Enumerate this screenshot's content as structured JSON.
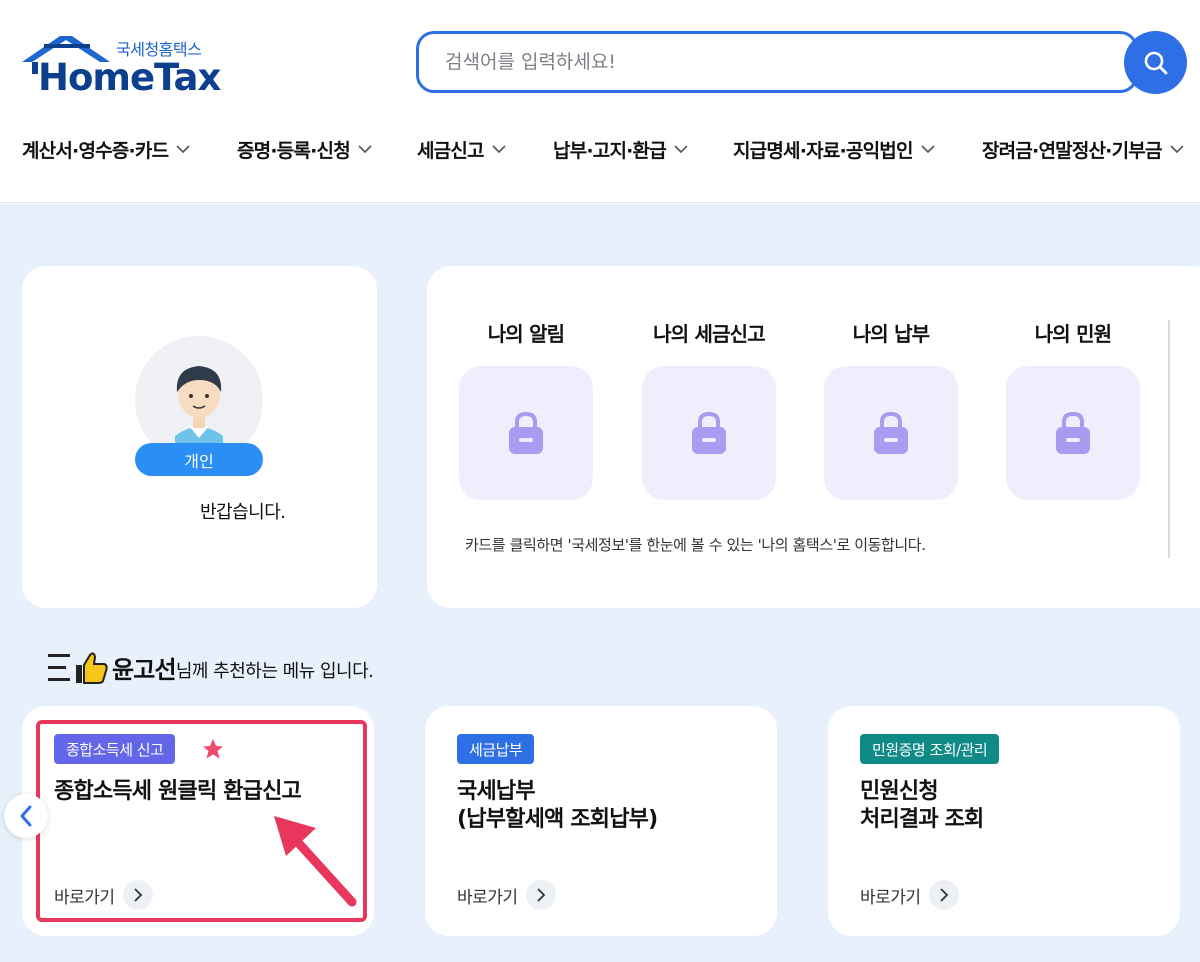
{
  "brand": {
    "sub": "국세청홈택스",
    "name": "HomeTax",
    "house_color": "#1e66cf"
  },
  "search": {
    "placeholder": "검색어를 입력하세요!"
  },
  "nav": {
    "items": [
      {
        "label": "계산서·영수증·카드"
      },
      {
        "label": "증명·등록·신청"
      },
      {
        "label": "세금신고"
      },
      {
        "label": "납부·고지·환급"
      },
      {
        "label": "지급명세·자료·공익법인"
      },
      {
        "label": "장려금·연말정산·기부금"
      }
    ]
  },
  "profile": {
    "badge": "개인",
    "greeting": "반갑습니다."
  },
  "my_services": {
    "items": [
      {
        "title": "나의 알림",
        "icon": "lock-icon"
      },
      {
        "title": "나의 세금신고",
        "icon": "lock-icon"
      },
      {
        "title": "나의 납부",
        "icon": "lock-icon"
      },
      {
        "title": "나의 민원",
        "icon": "lock-icon"
      }
    ],
    "note": "카드를 클릭하면 '국세정보'를 한눈에 볼 수 있는 '나의 홈택스'로 이동합니다."
  },
  "recommend": {
    "user_name": "윤고선",
    "suffix": "님께 추천하는 메뉴 입니다.",
    "cards": [
      {
        "tag": "종합소득세 신고",
        "tag_color": "#6366e8",
        "title_line1": "종합소득세 원클릭 환급신고",
        "title_line2": "",
        "go": "바로가기",
        "starred": true
      },
      {
        "tag": "세금납부",
        "tag_color": "#2f6fe6",
        "title_line1": "국세납부",
        "title_line2": "(납부할세액 조회납부)",
        "go": "바로가기",
        "starred": false
      },
      {
        "tag": "민원증명 조회/관리",
        "tag_color": "#0f8a86",
        "title_line1": "민원신청",
        "title_line2": "처리결과 조회",
        "go": "바로가기",
        "starred": false
      }
    ]
  },
  "colors": {
    "accent": "#2f6fe6",
    "highlight": "#e8365d",
    "background": "#e8f1fb",
    "lock": "#a99bf0"
  }
}
